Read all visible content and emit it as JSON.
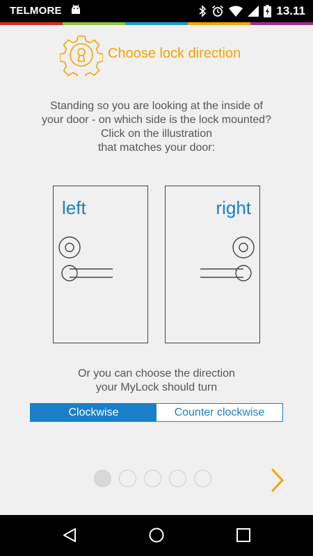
{
  "status_bar": {
    "carrier": "TELMORE",
    "time": "13.11",
    "icons": [
      "android-icon",
      "bluetooth-icon",
      "alarm-icon",
      "wifi-icon",
      "signal-icon",
      "battery-charging-icon"
    ]
  },
  "color_strip": [
    "#e0261d",
    "#8cc63f",
    "#1a9ad6",
    "#f5a300",
    "#a52c8f"
  ],
  "header": {
    "title": "Choose lock direction",
    "icon": "gear-keyhole-icon",
    "accent_color": "#f5a300"
  },
  "instructions": {
    "lines": [
      "Standing so you are looking at the inside of",
      "your door - on which side is the lock mounted?",
      "Click on the illustration",
      "that matches your door:"
    ]
  },
  "doors": {
    "left_label": "left",
    "right_label": "right"
  },
  "direction": {
    "lines": [
      "Or you can choose the direction",
      "your MyLock should turn"
    ],
    "options": [
      "Clockwise",
      "Counter clockwise"
    ],
    "selected": "Clockwise",
    "active_color": "#1a7fc9"
  },
  "pager": {
    "total": 5,
    "current": 1
  }
}
